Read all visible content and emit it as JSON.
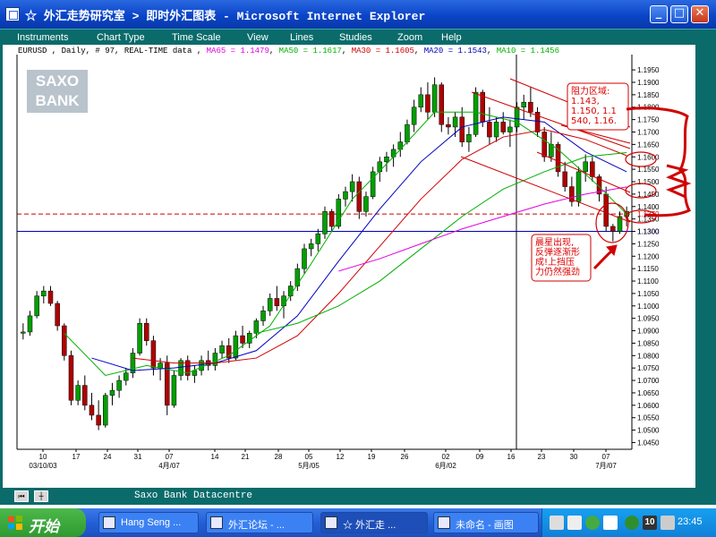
{
  "window": {
    "title": "☆ 外汇走势研究室 > 即时外汇图表 - Microsoft Internet Explorer",
    "buttons": {
      "minimize": "_",
      "maximize": "□",
      "close": "✕"
    }
  },
  "menu": {
    "items": [
      "Instruments",
      "Chart Type",
      "Time Scale",
      "View",
      "Lines",
      "Studies",
      "Zoom",
      "Help"
    ]
  },
  "legend": {
    "prefix": "EURUSD , Daily, # 97, REAL-TIME data ,",
    "ma": [
      {
        "label": "MA65 = 1.1479",
        "color": "#e000e0"
      },
      {
        "label": "MA50 = 1.1617",
        "color": "#00b000"
      },
      {
        "label": "MA30 = 1.1605",
        "color": "#d00000"
      },
      {
        "label": "MA20 = 1.1543",
        "color": "#0000c0"
      },
      {
        "label": "MA10 = 1.1456",
        "color": "#00b000"
      }
    ]
  },
  "logo": {
    "line1": "SAXO",
    "line2": "BANK"
  },
  "status": {
    "text": "Saxo Bank Datacentre"
  },
  "taskbar": {
    "start_label": "开始",
    "tasks": [
      {
        "label": "Hang Seng ..."
      },
      {
        "label": "外汇论坛 - ..."
      },
      {
        "label": "☆ 外汇走 ..."
      },
      {
        "label": "未命名 - 画图"
      }
    ],
    "clock": "23:45",
    "tray_badge": "10"
  },
  "chart_data": {
    "type": "candlestick",
    "symbol": "EURUSD",
    "ylim": [
      1.043,
      1.199
    ],
    "y_ticks": [
      "1.1950",
      "1.1900",
      "1.1850",
      "1.1800",
      "1.1750",
      "1.1700",
      "1.1650",
      "1.1600",
      "1.1550",
      "1.1500",
      "1.1450",
      "1.1400",
      "1.1350",
      "1.1300",
      "1.1250",
      "1.1200",
      "1.1150",
      "1.1100",
      "1.1050",
      "1.1000",
      "1.0950",
      "1.0900",
      "1.0850",
      "1.0800",
      "1.0750",
      "1.0700",
      "1.0650",
      "1.0600",
      "1.0550",
      "1.0500",
      "1.0450"
    ],
    "y_highlight": [
      {
        "label": "1.1370",
        "value": 1.137,
        "color": "#d00000"
      },
      {
        "label": "1.1300",
        "value": 1.13,
        "color": "#0000c0"
      }
    ],
    "x_day_labels": [
      "10",
      "17",
      "24",
      "31",
      "07",
      "14",
      "21",
      "28",
      "05",
      "12",
      "19",
      "26",
      "02",
      "09",
      "16",
      "23",
      "30",
      "07"
    ],
    "x_month_labels": [
      "03/10/03",
      "4月/07",
      "5月/05",
      "6月/02",
      "7月/07"
    ],
    "candles": [
      [
        1.089,
        1.093,
        1.0865,
        1.0895
      ],
      [
        1.0895,
        1.098,
        1.088,
        1.096
      ],
      [
        1.096,
        1.106,
        1.095,
        1.104
      ],
      [
        1.104,
        1.108,
        1.101,
        1.106
      ],
      [
        1.106,
        1.108,
        1.1,
        1.101
      ],
      [
        1.101,
        1.102,
        1.09,
        1.092
      ],
      [
        1.092,
        1.093,
        1.078,
        1.08
      ],
      [
        1.08,
        1.082,
        1.06,
        1.062
      ],
      [
        1.062,
        1.07,
        1.06,
        1.068
      ],
      [
        1.068,
        1.072,
        1.058,
        1.06
      ],
      [
        1.06,
        1.065,
        1.054,
        1.056
      ],
      [
        1.056,
        1.062,
        1.05,
        1.052
      ],
      [
        1.052,
        1.065,
        1.051,
        1.064
      ],
      [
        1.064,
        1.069,
        1.06,
        1.066
      ],
      [
        1.066,
        1.072,
        1.063,
        1.07
      ],
      [
        1.07,
        1.075,
        1.068,
        1.073
      ],
      [
        1.073,
        1.083,
        1.071,
        1.081
      ],
      [
        1.081,
        1.095,
        1.08,
        1.093
      ],
      [
        1.093,
        1.095,
        1.084,
        1.086
      ],
      [
        1.086,
        1.088,
        1.072,
        1.075
      ],
      [
        1.075,
        1.079,
        1.07,
        1.077
      ],
      [
        1.077,
        1.08,
        1.056,
        1.06
      ],
      [
        1.06,
        1.074,
        1.059,
        1.072
      ],
      [
        1.072,
        1.079,
        1.07,
        1.078
      ],
      [
        1.078,
        1.08,
        1.07,
        1.072
      ],
      [
        1.072,
        1.076,
        1.069,
        1.074
      ],
      [
        1.074,
        1.08,
        1.072,
        1.078
      ],
      [
        1.078,
        1.082,
        1.074,
        1.076
      ],
      [
        1.076,
        1.083,
        1.074,
        1.081
      ],
      [
        1.081,
        1.086,
        1.079,
        1.084
      ],
      [
        1.084,
        1.087,
        1.077,
        1.079
      ],
      [
        1.079,
        1.09,
        1.078,
        1.088
      ],
      [
        1.088,
        1.092,
        1.083,
        1.085
      ],
      [
        1.085,
        1.09,
        1.083,
        1.089
      ],
      [
        1.089,
        1.095,
        1.087,
        1.094
      ],
      [
        1.094,
        1.1,
        1.092,
        1.098
      ],
      [
        1.098,
        1.105,
        1.096,
        1.103
      ],
      [
        1.103,
        1.108,
        1.098,
        1.1
      ],
      [
        1.1,
        1.106,
        1.095,
        1.104
      ],
      [
        1.104,
        1.11,
        1.102,
        1.108
      ],
      [
        1.108,
        1.117,
        1.106,
        1.115
      ],
      [
        1.115,
        1.125,
        1.113,
        1.123
      ],
      [
        1.123,
        1.127,
        1.12,
        1.125
      ],
      [
        1.125,
        1.131,
        1.122,
        1.129
      ],
      [
        1.129,
        1.14,
        1.127,
        1.138
      ],
      [
        1.138,
        1.139,
        1.13,
        1.132
      ],
      [
        1.132,
        1.145,
        1.131,
        1.143
      ],
      [
        1.143,
        1.148,
        1.14,
        1.146
      ],
      [
        1.146,
        1.153,
        1.142,
        1.15
      ],
      [
        1.15,
        1.152,
        1.135,
        1.138
      ],
      [
        1.138,
        1.146,
        1.136,
        1.144
      ],
      [
        1.144,
        1.156,
        1.143,
        1.154
      ],
      [
        1.154,
        1.16,
        1.15,
        1.158
      ],
      [
        1.158,
        1.162,
        1.154,
        1.16
      ],
      [
        1.16,
        1.165,
        1.156,
        1.163
      ],
      [
        1.163,
        1.17,
        1.16,
        1.166
      ],
      [
        1.166,
        1.175,
        1.165,
        1.173
      ],
      [
        1.173,
        1.183,
        1.17,
        1.18
      ],
      [
        1.18,
        1.188,
        1.178,
        1.185
      ],
      [
        1.185,
        1.19,
        1.175,
        1.178
      ],
      [
        1.178,
        1.192,
        1.176,
        1.189
      ],
      [
        1.189,
        1.19,
        1.17,
        1.173
      ],
      [
        1.173,
        1.176,
        1.169,
        1.172
      ],
      [
        1.172,
        1.178,
        1.168,
        1.176
      ],
      [
        1.176,
        1.18,
        1.164,
        1.166
      ],
      [
        1.166,
        1.172,
        1.162,
        1.169
      ],
      [
        1.169,
        1.188,
        1.168,
        1.186
      ],
      [
        1.186,
        1.187,
        1.172,
        1.174
      ],
      [
        1.174,
        1.18,
        1.165,
        1.168
      ],
      [
        1.168,
        1.176,
        1.166,
        1.174
      ],
      [
        1.174,
        1.178,
        1.169,
        1.17
      ],
      [
        1.17,
        1.175,
        1.164,
        1.172
      ],
      [
        1.172,
        1.182,
        1.17,
        1.18
      ],
      [
        1.18,
        1.185,
        1.175,
        1.182
      ],
      [
        1.182,
        1.188,
        1.176,
        1.178
      ],
      [
        1.178,
        1.18,
        1.168,
        1.17
      ],
      [
        1.17,
        1.172,
        1.158,
        1.16
      ],
      [
        1.16,
        1.17,
        1.158,
        1.165
      ],
      [
        1.165,
        1.166,
        1.152,
        1.154
      ],
      [
        1.154,
        1.158,
        1.146,
        1.148
      ],
      [
        1.148,
        1.152,
        1.14,
        1.142
      ],
      [
        1.142,
        1.156,
        1.14,
        1.154
      ],
      [
        1.154,
        1.161,
        1.15,
        1.158
      ],
      [
        1.158,
        1.16,
        1.15,
        1.152
      ],
      [
        1.152,
        1.153,
        1.142,
        1.145
      ],
      [
        1.145,
        1.148,
        1.13,
        1.132
      ],
      [
        1.132,
        1.133,
        1.126,
        1.13
      ],
      [
        1.13,
        1.138,
        1.129,
        1.136
      ],
      [
        1.136,
        1.14,
        1.132,
        1.138
      ]
    ],
    "moving_averages": [
      {
        "name": "MA10",
        "color": "#00b000",
        "values": [
          [
            6,
            1.089
          ],
          [
            12,
            1.072
          ],
          [
            18,
            1.076
          ],
          [
            24,
            1.073
          ],
          [
            30,
            1.08
          ],
          [
            36,
            1.092
          ],
          [
            42,
            1.117
          ],
          [
            48,
            1.143
          ],
          [
            54,
            1.16
          ],
          [
            60,
            1.178
          ],
          [
            66,
            1.178
          ],
          [
            72,
            1.174
          ],
          [
            78,
            1.163
          ],
          [
            84,
            1.148
          ],
          [
            88,
            1.137
          ]
        ]
      },
      {
        "name": "MA20",
        "color": "#0000c0",
        "values": [
          [
            10,
            1.079
          ],
          [
            16,
            1.074
          ],
          [
            22,
            1.075
          ],
          [
            28,
            1.077
          ],
          [
            34,
            1.082
          ],
          [
            40,
            1.096
          ],
          [
            46,
            1.118
          ],
          [
            52,
            1.139
          ],
          [
            58,
            1.158
          ],
          [
            64,
            1.172
          ],
          [
            70,
            1.176
          ],
          [
            76,
            1.174
          ],
          [
            82,
            1.162
          ],
          [
            88,
            1.154
          ]
        ]
      },
      {
        "name": "MA30",
        "color": "#d00000",
        "values": [
          [
            16,
            1.079
          ],
          [
            22,
            1.077
          ],
          [
            28,
            1.077
          ],
          [
            34,
            1.079
          ],
          [
            40,
            1.088
          ],
          [
            46,
            1.105
          ],
          [
            52,
            1.124
          ],
          [
            58,
            1.143
          ],
          [
            64,
            1.159
          ],
          [
            70,
            1.168
          ],
          [
            76,
            1.171
          ],
          [
            82,
            1.167
          ],
          [
            88,
            1.1605
          ]
        ]
      },
      {
        "name": "MA50",
        "color": "#00b000",
        "values": [
          [
            34,
            1.089
          ],
          [
            40,
            1.093
          ],
          [
            46,
            1.1
          ],
          [
            52,
            1.11
          ],
          [
            58,
            1.123
          ],
          [
            64,
            1.136
          ],
          [
            70,
            1.147
          ],
          [
            76,
            1.154
          ],
          [
            82,
            1.16
          ],
          [
            88,
            1.1617
          ]
        ]
      },
      {
        "name": "MA65",
        "color": "#e000e0",
        "values": [
          [
            46,
            1.114
          ],
          [
            52,
            1.119
          ],
          [
            58,
            1.125
          ],
          [
            64,
            1.131
          ],
          [
            70,
            1.136
          ],
          [
            76,
            1.141
          ],
          [
            82,
            1.145
          ],
          [
            88,
            1.1479
          ]
        ]
      }
    ],
    "annotations": [
      {
        "text_lines": [
          "阻力区域:",
          "1.143,",
          "1.150, 1.1",
          "540, 1.16."
        ],
        "color": "#d00000"
      },
      {
        "text_lines": [
          "晨星出现,",
          "反弹逐渐形",
          "成!上挡压",
          "力仍然强劲"
        ],
        "color": "#d00000"
      }
    ]
  }
}
